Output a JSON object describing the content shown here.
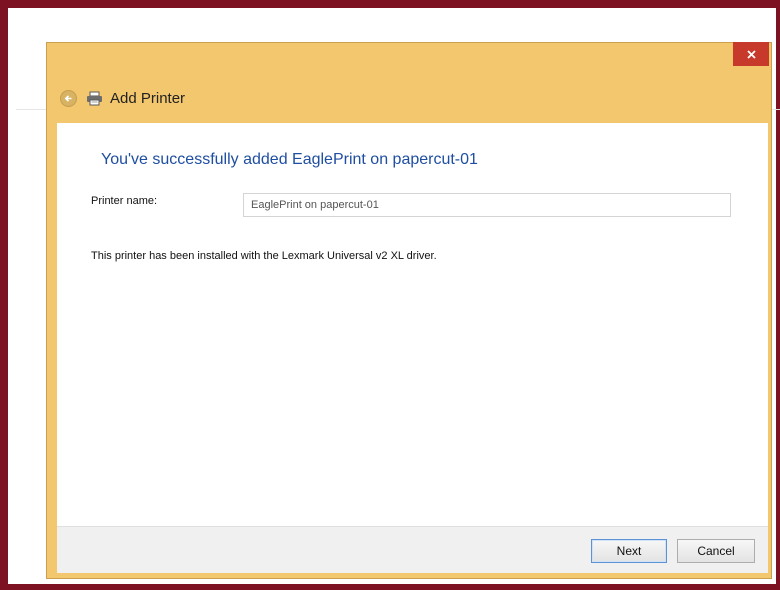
{
  "window": {
    "title": "Add Printer",
    "close_label": "×"
  },
  "content": {
    "heading": "You've successfully added EaglePrint on papercut-01",
    "printer_name_label": "Printer name:",
    "printer_name_value": "EaglePrint on papercut-01",
    "driver_message": "This printer has been installed with the Lexmark Universal v2 XL driver."
  },
  "footer": {
    "next_label": "Next",
    "cancel_label": "Cancel"
  },
  "icons": {
    "back": "back-arrow-icon",
    "printer": "printer-icon",
    "close": "close-icon"
  },
  "colors": {
    "title_bar": "#f3c76e",
    "close_button": "#c7392b",
    "heading_text": "#1f4ea1",
    "frame_border": "#7d1222"
  }
}
